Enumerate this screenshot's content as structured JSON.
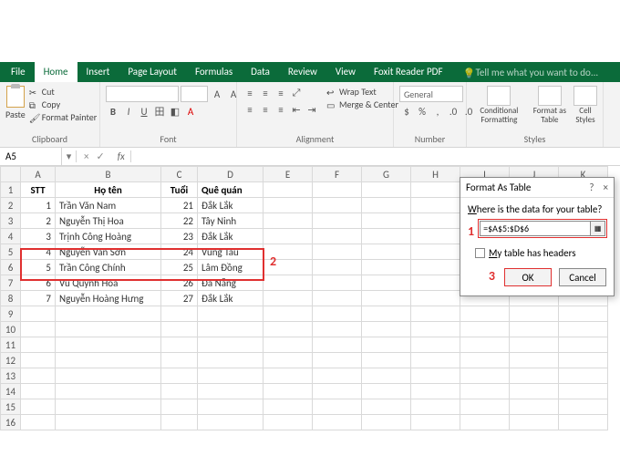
{
  "ribbon": {
    "tabs": [
      "File",
      "Home",
      "Insert",
      "Page Layout",
      "Formulas",
      "Data",
      "Review",
      "View",
      "Foxit Reader PDF"
    ],
    "tell_me": "Tell me what you want to do...",
    "groups": {
      "clipboard": {
        "label": "Clipboard",
        "paste": "Paste",
        "cut": "Cut",
        "copy": "Copy",
        "format_painter": "Format Painter"
      },
      "font": {
        "label": "Font",
        "bold": "B",
        "italic": "I",
        "underline": "U"
      },
      "alignment": {
        "label": "Alignment",
        "wrap": "Wrap Text",
        "merge": "Merge & Center"
      },
      "number": {
        "label": "Number",
        "format": "General"
      },
      "styles": {
        "label": "Styles",
        "conditional": "Conditional Formatting",
        "format_table": "Format as Table",
        "cell_styles": "Cell Styles"
      }
    }
  },
  "namebox": {
    "ref": "A5",
    "fx": "fx"
  },
  "sheet": {
    "cols": [
      "A",
      "B",
      "C",
      "D",
      "E",
      "F",
      "G",
      "H",
      "I",
      "J",
      "K"
    ],
    "header": {
      "stt": "STT",
      "hoten": "Họ tên",
      "tuoi": "Tuổi",
      "quequan": "Quê quán"
    },
    "rows": [
      {
        "n": 1,
        "stt": "1",
        "hoten": "Trần Văn Nam",
        "tuoi": "21",
        "que": "Đắk Lắk"
      },
      {
        "n": 2,
        "stt": "2",
        "hoten": "Nguyễn Thị Hoa",
        "tuoi": "22",
        "que": "Tây Ninh"
      },
      {
        "n": 3,
        "stt": "3",
        "hoten": "Trịnh Công Hoàng",
        "tuoi": "23",
        "que": "Đắk Lắk"
      },
      {
        "n": 4,
        "stt": "4",
        "hoten": "Nguyễn Văn Sơn",
        "tuoi": "24",
        "que": "Vũng Tàu"
      },
      {
        "n": 5,
        "stt": "5",
        "hoten": "Trần Công Chính",
        "tuoi": "25",
        "que": "Lâm Đồng"
      },
      {
        "n": 6,
        "stt": "6",
        "hoten": "Vũ Quỳnh Hoa",
        "tuoi": "26",
        "que": "Đà Nẵng"
      },
      {
        "n": 7,
        "stt": "7",
        "hoten": "Nguyễn Hoàng Hưng",
        "tuoi": "27",
        "que": "Đắk Lắk"
      }
    ]
  },
  "dialog": {
    "title": "Format As Table",
    "prompt": "Where is the data for your table?",
    "range": "=$A$5:$D$6",
    "headers_label": "My table has headers",
    "ok": "OK",
    "cancel": "Cancel"
  },
  "callouts": {
    "one": "1",
    "two": "2",
    "three": "3"
  }
}
